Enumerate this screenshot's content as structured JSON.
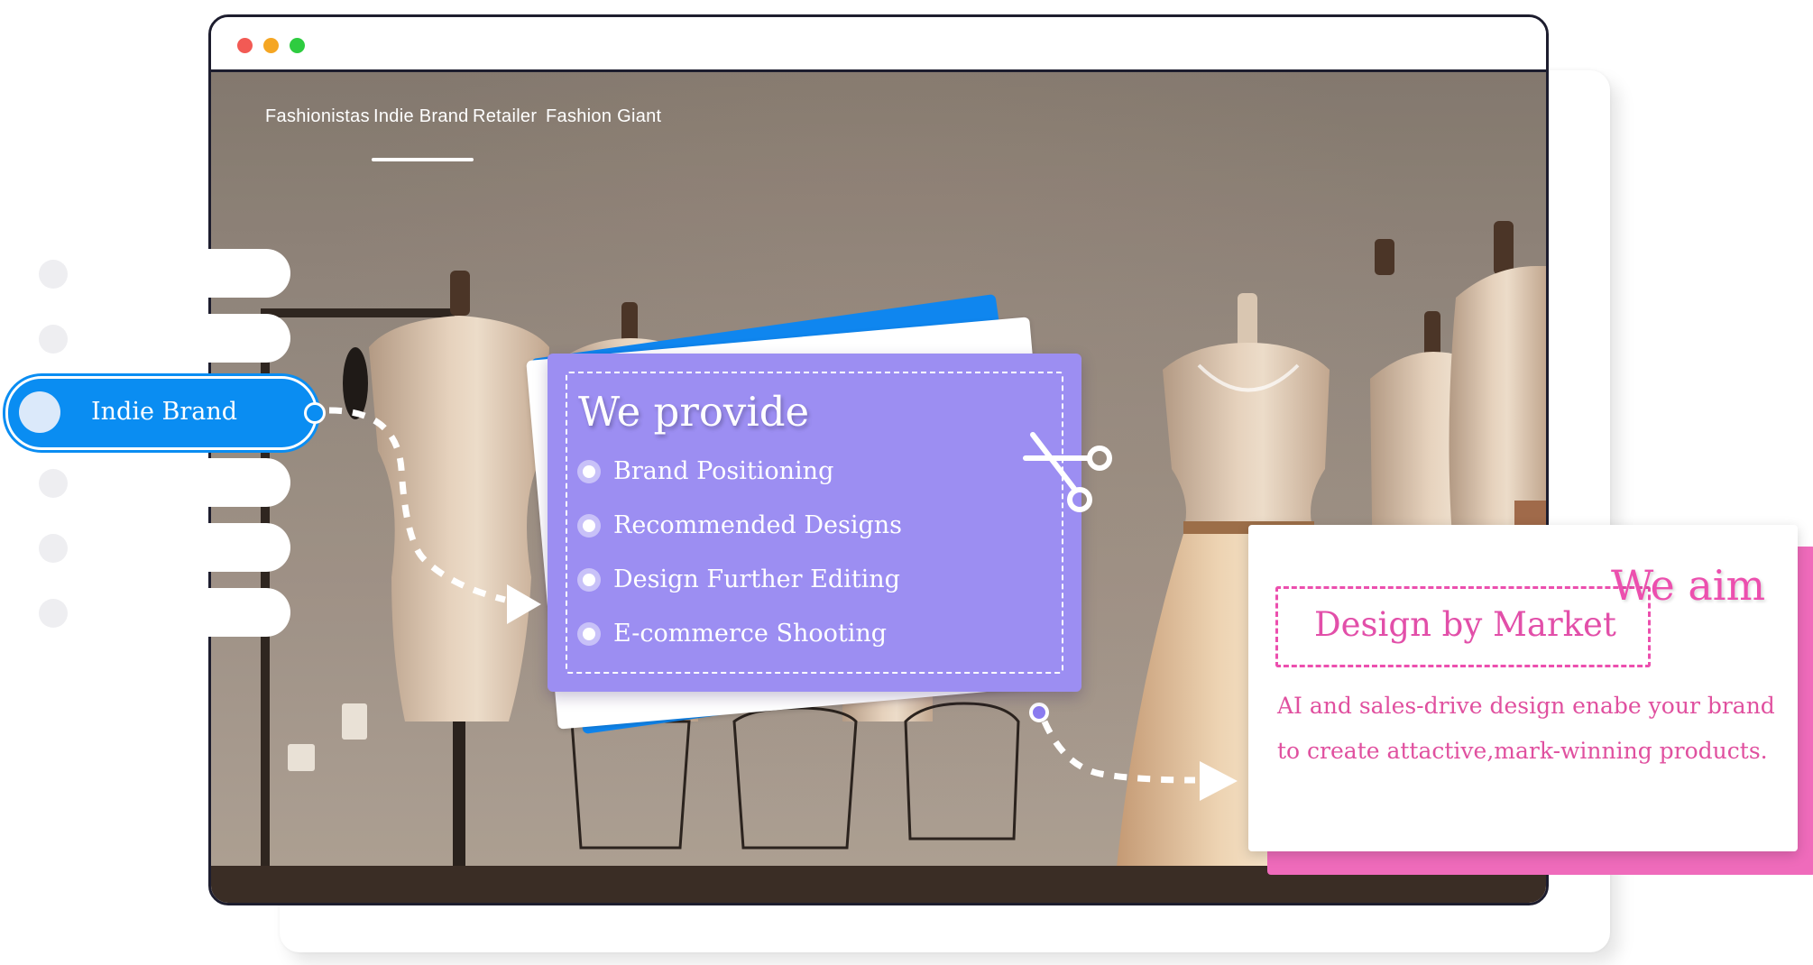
{
  "window": {
    "controls": [
      "close",
      "minimize",
      "maximize"
    ],
    "control_colors": [
      "#f25a54",
      "#f5a623",
      "#2ecc40"
    ]
  },
  "nav": {
    "items": [
      {
        "label": "Fashionistas"
      },
      {
        "label": "Indie Brand",
        "active": true
      },
      {
        "label": "Retailer"
      },
      {
        "label": "Fashion Giant"
      }
    ]
  },
  "sidebar": {
    "active_label": "Indie Brand",
    "accent_color": "#0a8df2"
  },
  "provide": {
    "title": "We provide",
    "items": [
      "Brand Positioning",
      "Recommended Designs",
      "Design Further Editing",
      "E-commerce Shooting"
    ],
    "card_color": "#9c8ef2",
    "icon": "scissors-icon"
  },
  "aim": {
    "title": "We aim",
    "heading": "Design by Market",
    "description": "AI  and sales-drive design enabe your brand to create attactive,mark-winning products.",
    "accent_color": "#ec4fae"
  }
}
